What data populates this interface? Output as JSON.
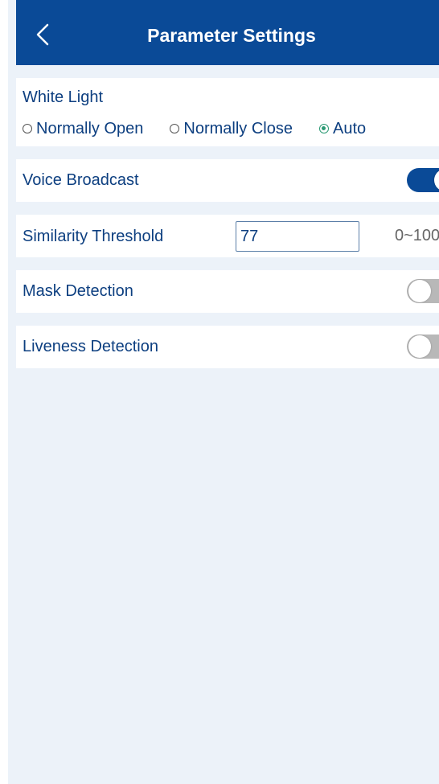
{
  "header": {
    "title": "Parameter Settings",
    "back_icon": "chevron-left-icon"
  },
  "white_light": {
    "label": "White Light",
    "options": [
      {
        "label": "Normally Open",
        "selected": false
      },
      {
        "label": "Normally Close",
        "selected": false
      },
      {
        "label": "Auto",
        "selected": true
      }
    ]
  },
  "voice_broadcast": {
    "label": "Voice Broadcast",
    "enabled": true
  },
  "similarity_threshold": {
    "label": "Similarity Threshold",
    "value": "77",
    "range": "0~100"
  },
  "mask_detection": {
    "label": "Mask Detection",
    "enabled": false
  },
  "liveness_detection": {
    "label": "Liveness Detection",
    "enabled": false
  },
  "colors": {
    "header": "#0a4a97",
    "text": "#0d3f80",
    "background": "#ecf2f9",
    "radio_selected": "#2c9a74",
    "toggle_off": "#b8b8b8"
  }
}
